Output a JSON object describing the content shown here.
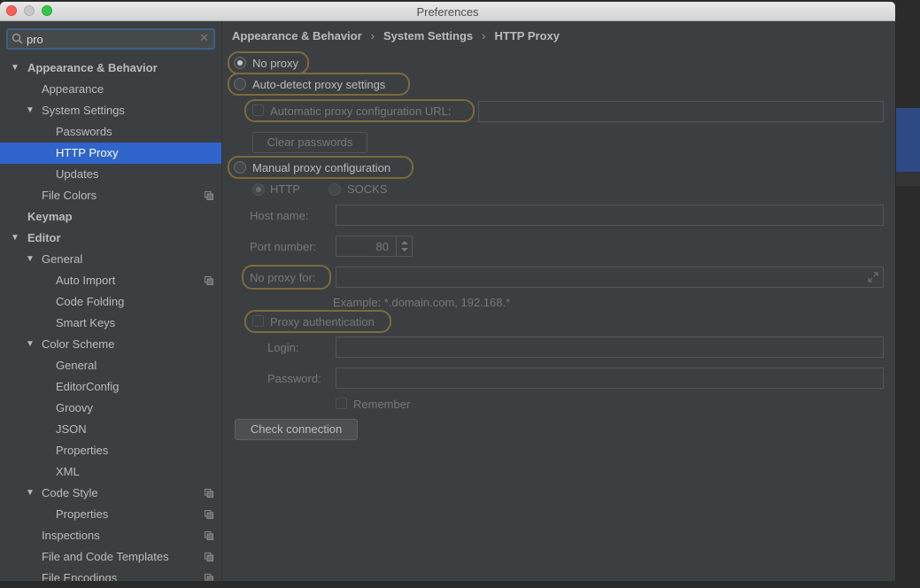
{
  "window": {
    "title": "Preferences"
  },
  "search": {
    "value": "pro"
  },
  "tree": [
    {
      "label": "Appearance & Behavior",
      "level": 0,
      "arrow": true,
      "bold": true
    },
    {
      "label": "Appearance",
      "level": 1
    },
    {
      "label": "System Settings",
      "level": 1,
      "arrow": true
    },
    {
      "label": "Passwords",
      "level": 2
    },
    {
      "label": "HTTP Proxy",
      "level": 2,
      "selected": true
    },
    {
      "label": "Updates",
      "level": 2
    },
    {
      "label": "File Colors",
      "level": 1,
      "copy": true
    },
    {
      "label": "Keymap",
      "level": 0,
      "bold": true
    },
    {
      "label": "Editor",
      "level": 0,
      "arrow": true,
      "bold": true
    },
    {
      "label": "General",
      "level": 1,
      "arrow": true
    },
    {
      "label": "Auto Import",
      "level": 2,
      "copy": true
    },
    {
      "label": "Code Folding",
      "level": 2
    },
    {
      "label": "Smart Keys",
      "level": 2
    },
    {
      "label": "Color Scheme",
      "level": 1,
      "arrow": true
    },
    {
      "label": "General",
      "level": 2
    },
    {
      "label": "EditorConfig",
      "level": 2
    },
    {
      "label": "Groovy",
      "level": 2
    },
    {
      "label": "JSON",
      "level": 2
    },
    {
      "label": "Properties",
      "level": 2
    },
    {
      "label": "XML",
      "level": 2
    },
    {
      "label": "Code Style",
      "level": 1,
      "arrow": true,
      "copy": true
    },
    {
      "label": "Properties",
      "level": 2,
      "copy": true
    },
    {
      "label": "Inspections",
      "level": 1,
      "copy": true
    },
    {
      "label": "File and Code Templates",
      "level": 1,
      "copy": true
    },
    {
      "label": "File Encodings",
      "level": 1,
      "copy": true
    }
  ],
  "breadcrumb": [
    "Appearance & Behavior",
    "System Settings",
    "HTTP Proxy"
  ],
  "proxy": {
    "no_proxy": "No proxy",
    "auto_detect": "Auto-detect proxy settings",
    "auto_config_url": "Automatic proxy configuration URL:",
    "clear_passwords": "Clear passwords",
    "manual": "Manual proxy configuration",
    "http": "HTTP",
    "socks": "SOCKS",
    "host_name": "Host name:",
    "port_number": "Port number:",
    "port_value": "80",
    "no_proxy_for": "No proxy for:",
    "example": "Example: *.domain.com, 192.168.*",
    "proxy_auth": "Proxy authentication",
    "login": "Login:",
    "password": "Password:",
    "remember": "Remember",
    "check_connection": "Check connection"
  },
  "icons": {
    "search": "search-icon",
    "clear": "close-icon",
    "copy": "copy-icon",
    "expand": "expand-icon",
    "arrow": "triangle-down-icon"
  },
  "colors": {
    "selection": "#2f65ca",
    "highlight": "#7d6a3c"
  }
}
